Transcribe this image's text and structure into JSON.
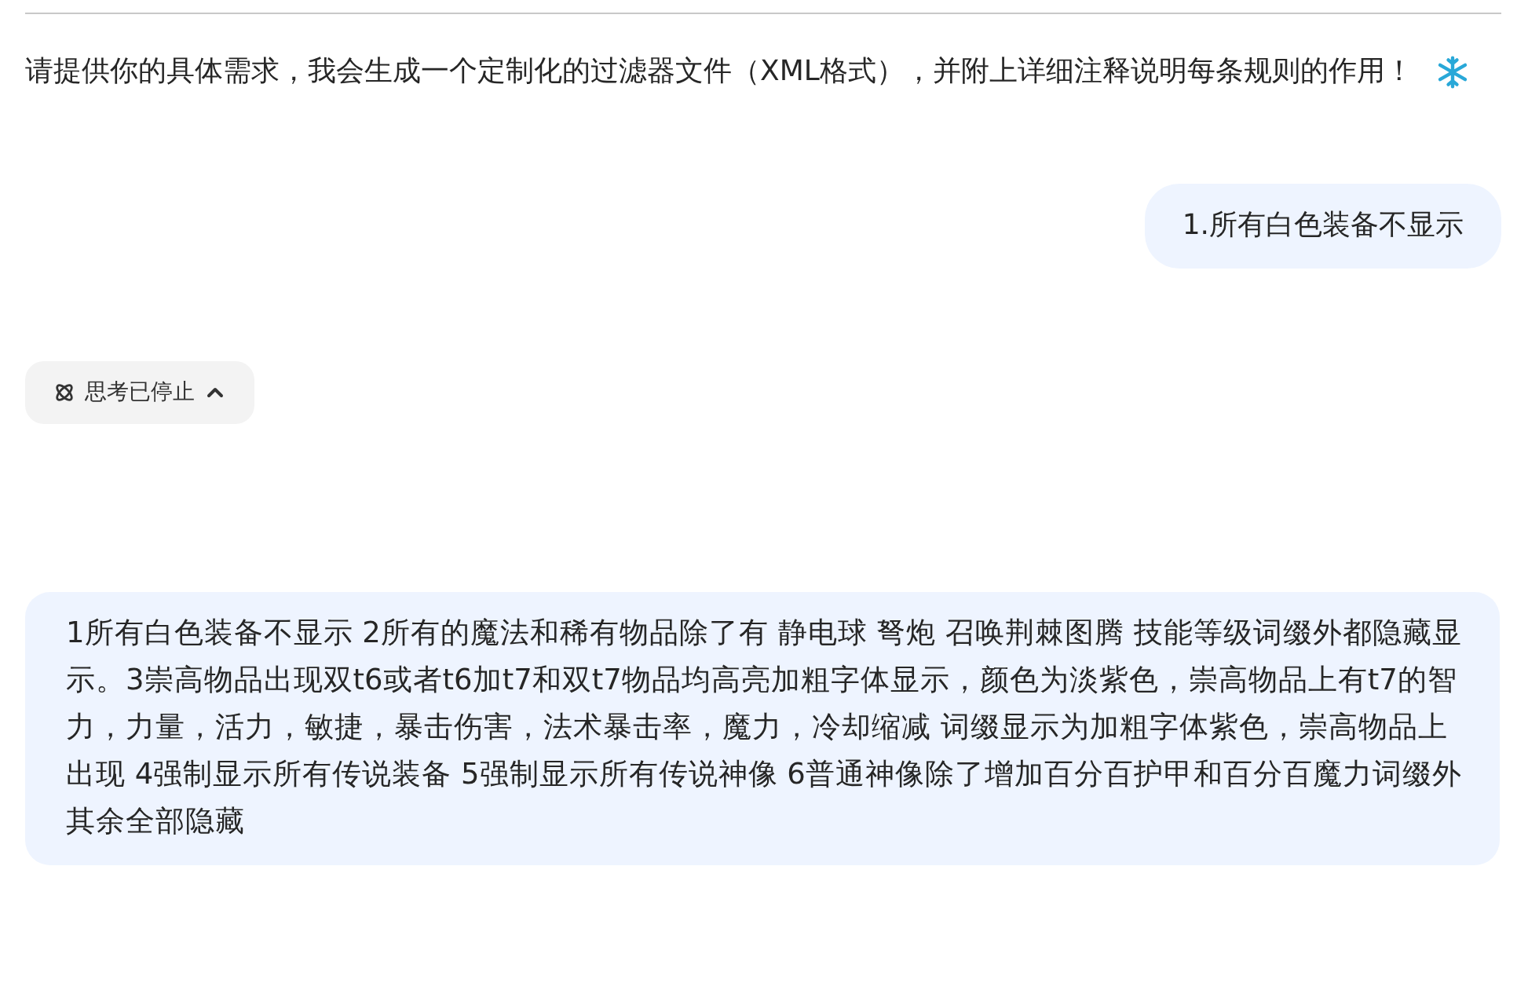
{
  "assistant_message": {
    "text": "请提供你的具体需求，我会生成一个定制化的过滤器文件（XML格式），并附上详细注释说明每条规则的作用！"
  },
  "user_messages": [
    {
      "text": "1.所有白色装备不显示"
    },
    {
      "text": "1所有白色装备不显示 2所有的魔法和稀有物品除了有 静电球 弩炮 召唤荆棘图腾 技能等级词缀外都隐藏显示。3崇高物品出现双t6或者t6加t7和双t7物品均高亮加粗字体显示，颜色为淡紫色，崇高物品上有t7的智力，力量，活力，敏捷，暴击伤害，法术暴击率，魔力，冷却缩减 词缀显示为加粗字体紫色，崇高物品上出现 4强制显示所有传说装备 5强制显示所有传说神像 6普通神像除了增加百分百护甲和百分百魔力词缀外其余全部隐藏"
    }
  ],
  "thinking_toggle": {
    "label": "思考已停止",
    "expanded": true
  }
}
